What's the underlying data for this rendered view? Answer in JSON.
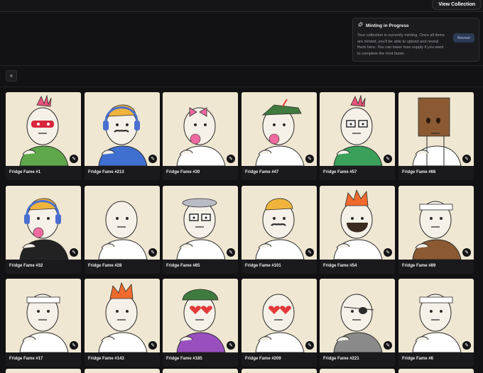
{
  "header": {
    "view_collection": "View Collection"
  },
  "minting": {
    "title": "Minting in Progress",
    "message": "Your collection is currently minting. Once all items are minted, you'll be able to upload and reveal them here. You can lower max supply if you want to complete the mint faster.",
    "reveal_button": "Reveal",
    "icon": "rocket-icon"
  },
  "collapse_icon": "double-chevron-left-icon",
  "items": [
    {
      "name": "Fridge Fame #1",
      "bg": "#efe7d2",
      "hair": "#e9527a",
      "accent": "#d7263d",
      "shirt": "#5fa84a"
    },
    {
      "name": "Fridge Fame #213",
      "bg": "#efe7d2",
      "hair": "#f0b43c",
      "accent": "#4a6fd0",
      "shirt": "#3f6fd0"
    },
    {
      "name": "Fridge Fame #30",
      "bg": "#efe7d2",
      "hair": "#f06aa0",
      "accent": "#f06aa0",
      "shirt": "#ffffff"
    },
    {
      "name": "Fridge Fame #47",
      "bg": "#efe7d2",
      "hair": "#3f7a3f",
      "accent": "#e33a3a",
      "shirt": "#ffffff"
    },
    {
      "name": "Fridge Fame #57",
      "bg": "#efe7d2",
      "hair": "#e9527a",
      "accent": "#f06aa0",
      "shirt": "#3aa05a"
    },
    {
      "name": "Fridge Fame #66",
      "bg": "#efe7d2",
      "hair": "#8b5a33",
      "accent": "#8b5a33",
      "shirt": "#ffffff"
    },
    {
      "name": "Fridge Fame #32",
      "bg": "#efe7d2",
      "hair": "#f0b43c",
      "accent": "#4a6fd0",
      "shirt": "#222222"
    },
    {
      "name": "Fridge Fame #28",
      "bg": "#efe7d2",
      "hair": "#cfd8e8",
      "accent": "#e33a3a",
      "shirt": "#ffffff"
    },
    {
      "name": "Fridge Fame #65",
      "bg": "#efe7d2",
      "hair": "#b9bcc4",
      "accent": "#777777",
      "shirt": "#ffffff"
    },
    {
      "name": "Fridge Fame #101",
      "bg": "#efe7d2",
      "hair": "#f0b43c",
      "accent": "#e8e0cc",
      "shirt": "#ffffff"
    },
    {
      "name": "Fridge Fame #54",
      "bg": "#efe7d2",
      "hair": "#ef6a2c",
      "accent": "#4a2a1a",
      "shirt": "#ffffff"
    },
    {
      "name": "Fridge Fame #89",
      "bg": "#efe7d2",
      "hair": "#ffffff",
      "accent": "#e33a3a",
      "shirt": "#8b5a33"
    },
    {
      "name": "Fridge Fame #17",
      "bg": "#efe7d2",
      "hair": "#ffffff",
      "accent": "#e33a3a",
      "shirt": "#ffffff"
    },
    {
      "name": "Fridge Fame #143",
      "bg": "#efe7d2",
      "hair": "#ef6a2c",
      "accent": "#8b5a33",
      "shirt": "#ffffff"
    },
    {
      "name": "Fridge Fame #185",
      "bg": "#efe7d2",
      "hair": "#3f7a3f",
      "accent": "#e33a3a",
      "shirt": "#9a4fbf"
    },
    {
      "name": "Fridge Fame #209",
      "bg": "#efe7d2",
      "hair": "#efe7d2",
      "accent": "#e33a3a",
      "shirt": "#ffffff"
    },
    {
      "name": "Fridge Fame #221",
      "bg": "#efe7d2",
      "hair": "#efe7d2",
      "accent": "#222222",
      "shirt": "#8a8a8a"
    },
    {
      "name": "Fridge Fame #6",
      "bg": "#efe7d2",
      "hair": "#ffffff",
      "accent": "#6fa0e0",
      "shirt": "#ffffff"
    }
  ],
  "edit_icon": "pencil-icon"
}
